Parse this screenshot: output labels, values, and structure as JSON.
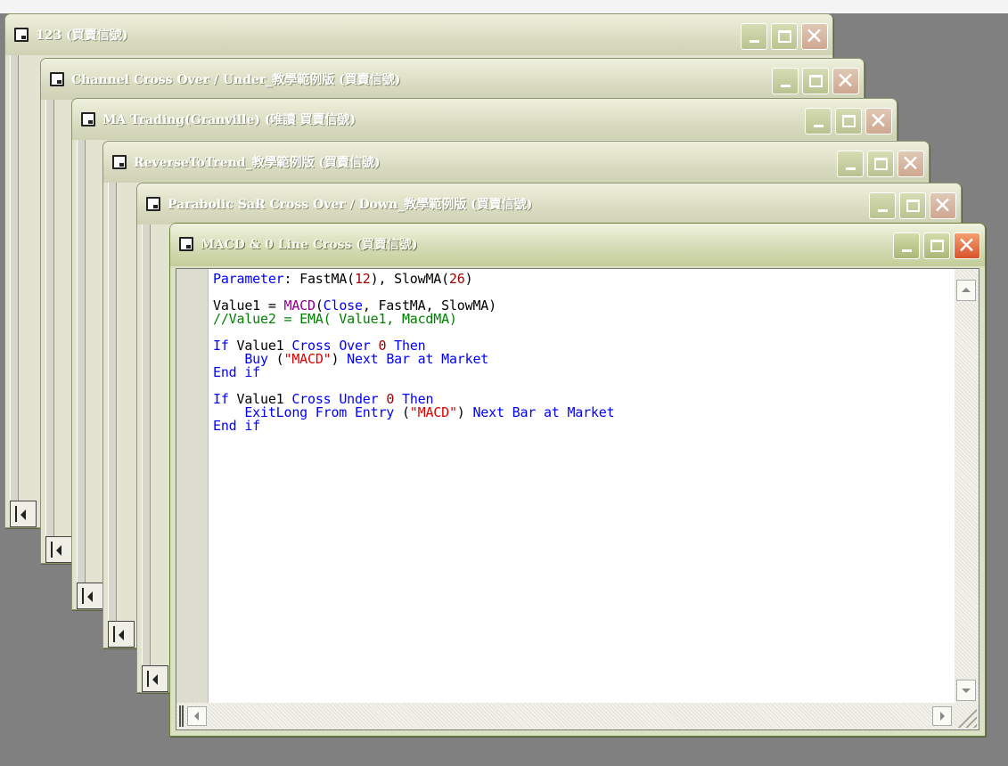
{
  "windows": [
    {
      "title": "123 (買賣信號)"
    },
    {
      "title": "Channel Cross Over / Under_教學範例版 (買賣信號)"
    },
    {
      "title": "MA Trading(Granville) (唯讀 買賣信號)"
    },
    {
      "title": "ReverseToTrend_教學範例版 (買賣信號)"
    },
    {
      "title": "Parabolic SaR Cross Over / Down_教學範例版 (買賣信號)"
    },
    {
      "title": "MACD & 0 Line Cross (買賣信號)"
    }
  ],
  "editor": {
    "lines": [
      [
        {
          "t": "Parameter",
          "c": "kw"
        },
        {
          "t": ": FastMA(",
          "c": "pl"
        },
        {
          "t": "12",
          "c": "num"
        },
        {
          "t": "), SlowMA(",
          "c": "pl"
        },
        {
          "t": "26",
          "c": "num"
        },
        {
          "t": ")",
          "c": "pl"
        }
      ],
      [],
      [
        {
          "t": "Value1 = ",
          "c": "pl"
        },
        {
          "t": "MACD",
          "c": "fn"
        },
        {
          "t": "(",
          "c": "pl"
        },
        {
          "t": "Close",
          "c": "kw"
        },
        {
          "t": ", FastMA, SlowMA)",
          "c": "pl"
        }
      ],
      [
        {
          "t": "//Value2 = EMA( Value1, MacdMA)",
          "c": "cm"
        }
      ],
      [],
      [
        {
          "t": "If",
          "c": "kw"
        },
        {
          "t": " Value1 ",
          "c": "pl"
        },
        {
          "t": "Cross Over",
          "c": "kw"
        },
        {
          "t": " ",
          "c": "pl"
        },
        {
          "t": "0",
          "c": "num"
        },
        {
          "t": " ",
          "c": "pl"
        },
        {
          "t": "Then",
          "c": "kw"
        }
      ],
      [
        {
          "t": "    ",
          "c": "pl"
        },
        {
          "t": "Buy",
          "c": "kw"
        },
        {
          "t": " (",
          "c": "pl"
        },
        {
          "t": "\"MACD\"",
          "c": "str"
        },
        {
          "t": ") ",
          "c": "pl"
        },
        {
          "t": "Next Bar at Market",
          "c": "kw"
        }
      ],
      [
        {
          "t": "End if",
          "c": "kw"
        }
      ],
      [],
      [
        {
          "t": "If",
          "c": "kw"
        },
        {
          "t": " Value1 ",
          "c": "pl"
        },
        {
          "t": "Cross Under",
          "c": "kw"
        },
        {
          "t": " ",
          "c": "pl"
        },
        {
          "t": "0",
          "c": "num"
        },
        {
          "t": " ",
          "c": "pl"
        },
        {
          "t": "Then",
          "c": "kw"
        }
      ],
      [
        {
          "t": "    ",
          "c": "pl"
        },
        {
          "t": "ExitLong From Entry",
          "c": "kw"
        },
        {
          "t": " (",
          "c": "pl"
        },
        {
          "t": "\"MACD\"",
          "c": "str"
        },
        {
          "t": ") ",
          "c": "pl"
        },
        {
          "t": "Next Bar at Market",
          "c": "kw"
        }
      ],
      [
        {
          "t": "End if",
          "c": "kw"
        }
      ]
    ]
  },
  "colors": {
    "keyword": "#0000ff",
    "number": "#a00000",
    "function": "#8b008b",
    "string": "#e00000",
    "comment": "#008000",
    "plain": "#000000"
  },
  "icons": {
    "window_icon": "document-icon",
    "minimize": "minimize-icon",
    "maximize": "maximize-icon",
    "close": "close-icon",
    "close_glyph": "✕"
  }
}
